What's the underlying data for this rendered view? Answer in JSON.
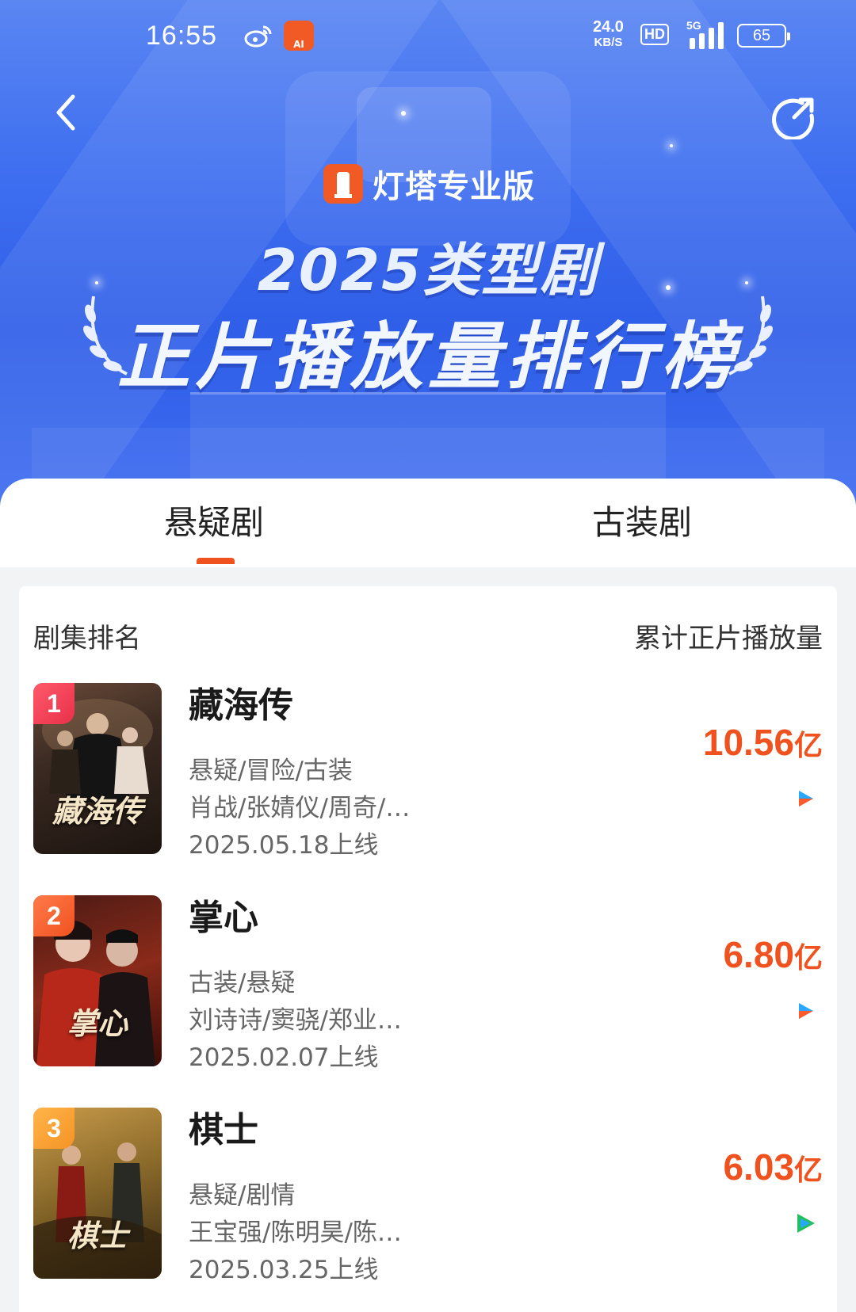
{
  "status_bar": {
    "time": "16:55",
    "net_speed_value": "24.0",
    "net_speed_unit": "KB/S",
    "hd_label": "HD",
    "network": "5G",
    "battery": "65",
    "app_icon_label": "AI"
  },
  "header": {
    "brand_name": "灯塔专业版",
    "title_line1": "2025类型剧",
    "title_line2": "正片播放量排行榜"
  },
  "tabs": [
    {
      "label": "悬疑剧",
      "active": true
    },
    {
      "label": "古装剧",
      "active": false
    }
  ],
  "list": {
    "left_header": "剧集排名",
    "right_header": "累计正片播放量",
    "items": [
      {
        "rank": "1",
        "title": "藏海传",
        "poster_text": "藏海传",
        "genre": "悬疑/冒险/古装",
        "cast": "肖战/张婧仪/周奇/…",
        "release": "2025.05.18上线",
        "value": "10.56",
        "unit": "亿",
        "platform_icon": "youku-icon"
      },
      {
        "rank": "2",
        "title": "掌心",
        "poster_text": "掌心",
        "genre": "古装/悬疑",
        "cast": "刘诗诗/窦骁/郑业…",
        "release": "2025.02.07上线",
        "value": "6.80",
        "unit": "亿",
        "platform_icon": "youku-icon"
      },
      {
        "rank": "3",
        "title": "棋士",
        "poster_text": "棋士",
        "genre": "悬疑/剧情",
        "cast": "王宝强/陈明昊/陈…",
        "release": "2025.03.25上线",
        "value": "6.03",
        "unit": "亿",
        "platform_icon": "tencent-video-icon"
      }
    ]
  },
  "colors": {
    "accent": "#f0521f",
    "banner_blue": "#3e6ef0",
    "rank1": "#e8304a",
    "rank2": "#f0521f",
    "rank3": "#f59325"
  }
}
